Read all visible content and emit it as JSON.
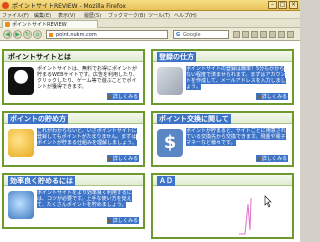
{
  "window": {
    "title": "ポイントサイトREVIEW - Mozilla Firefox"
  },
  "menu": {
    "items": [
      "ファイル(F)",
      "編集(E)",
      "表示(V)",
      "履歴(S)",
      "ブックマーク(B)",
      "ツール(T)",
      "ヘルプ(H)"
    ]
  },
  "tab": {
    "title": "ポイントサイトREVIEW"
  },
  "nav": {
    "url": "point.nukm.com",
    "search_engine": "Google",
    "search_placeholder": ""
  },
  "panels": [
    {
      "title": "ポイントサイトとは",
      "text": "ポイントサイトは、無料でお得にポイントが貯まるWEBサイトです。広告を利用したり、クリックしたり、ゲーム等で遊ぶことでポイントが獲得できます。",
      "more": "詳しくみる"
    },
    {
      "title": "登録の仕方",
      "text": "ポイントサイトの登録は簡単！5分もかからない程度で済ませられます。まずはアカウントを作成して、メールアドレスを入力しましょう。",
      "more": "詳しくみる"
    },
    {
      "title": "ポイントの貯め方",
      "text": "これがわからないと、いざポイントサイトに登録してもポイントがたまりません。まずはポイントが貯まる仕組みを理解しましょう。",
      "more": "詳しくみる"
    },
    {
      "title": "ポイント交換に関して",
      "text": "ポイントが貯まると、サイトごとに用意されている交換先から交換できます。現金や電子マネーなど様々です。",
      "more": "詳しくみる"
    },
    {
      "title": "効率良く貯めるには",
      "text": "ポイントサイトをより効率良く利用するには、コツが必要です。上手な使い方を覚えて、たくさんポイントを貯めましょう。",
      "more": "詳しくみる"
    },
    {
      "title": "ＡＤ",
      "text": "",
      "more": ""
    }
  ],
  "colors": {
    "panel_border": "#6c9a2c",
    "selection": "#3d74c8",
    "title_bar": "#e8c25a"
  }
}
